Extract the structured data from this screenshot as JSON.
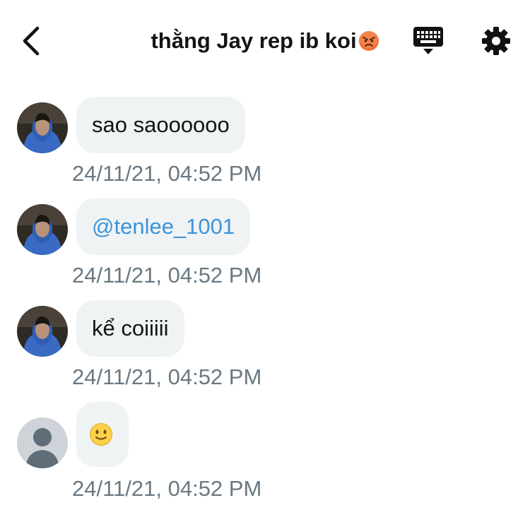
{
  "header": {
    "title": "thằng Jay rep ib koi",
    "title_emoji": "angry-face-emoji"
  },
  "messages": [
    {
      "text": "sao saoooooo",
      "timestamp": "24/11/21, 04:52 PM",
      "avatar": "photo"
    },
    {
      "text": "@tenlee_1001",
      "timestamp": "24/11/21, 04:52 PM",
      "avatar": "photo",
      "mention": true
    },
    {
      "text": "kể coiiiii",
      "timestamp": "24/11/21, 04:52 PM",
      "avatar": "photo"
    },
    {
      "text": "",
      "emoji": "slightly-smiling-face",
      "timestamp": "24/11/21, 04:52 PM",
      "avatar": "default"
    }
  ],
  "colors": {
    "bubble_bg": "#eff3f4",
    "mention": "#3b94d9",
    "timestamp": "#697882"
  }
}
